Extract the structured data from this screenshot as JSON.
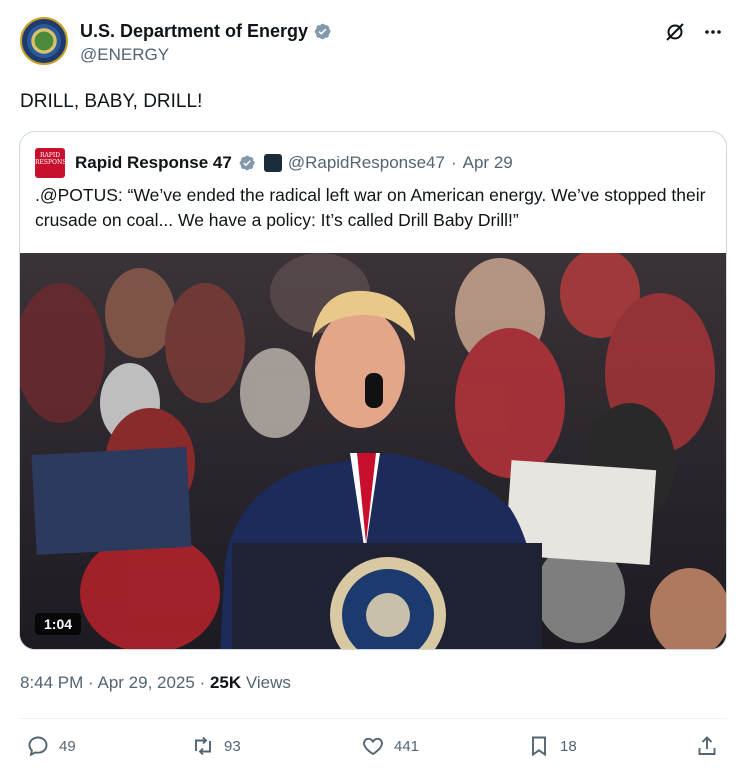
{
  "author": {
    "display_name": "U.S. Department of Energy",
    "handle": "@ENERGY"
  },
  "icons": {
    "verified": "verified-badge-icon",
    "grok": "grok-icon",
    "more": "more-icon"
  },
  "tweet": {
    "text": "DRILL, BABY, DRILL!"
  },
  "quote": {
    "avatar_text": "RAPID RESPONSE",
    "display_name": "Rapid Response 47",
    "handle": "@RapidResponse47",
    "separator": "·",
    "date": "Apr 29",
    "text": ".@POTUS: “We’ve ended the radical left war on American energy. We’ve stopped their crusade on coal... We have a policy: It’s called Drill Baby Drill!”",
    "video_duration": "1:04"
  },
  "meta": {
    "time": "8:44 PM",
    "sep1": " · ",
    "date": "Apr 29, 2025",
    "sep2": " · ",
    "views_count": "25K",
    "views_label": " Views"
  },
  "actions": {
    "replies": "49",
    "reposts": "93",
    "likes": "441",
    "bookmarks": "18"
  },
  "colors": {
    "verified": "#829aab",
    "muted": "#536471",
    "text": "#0f1419",
    "border": "#cfd9de"
  }
}
